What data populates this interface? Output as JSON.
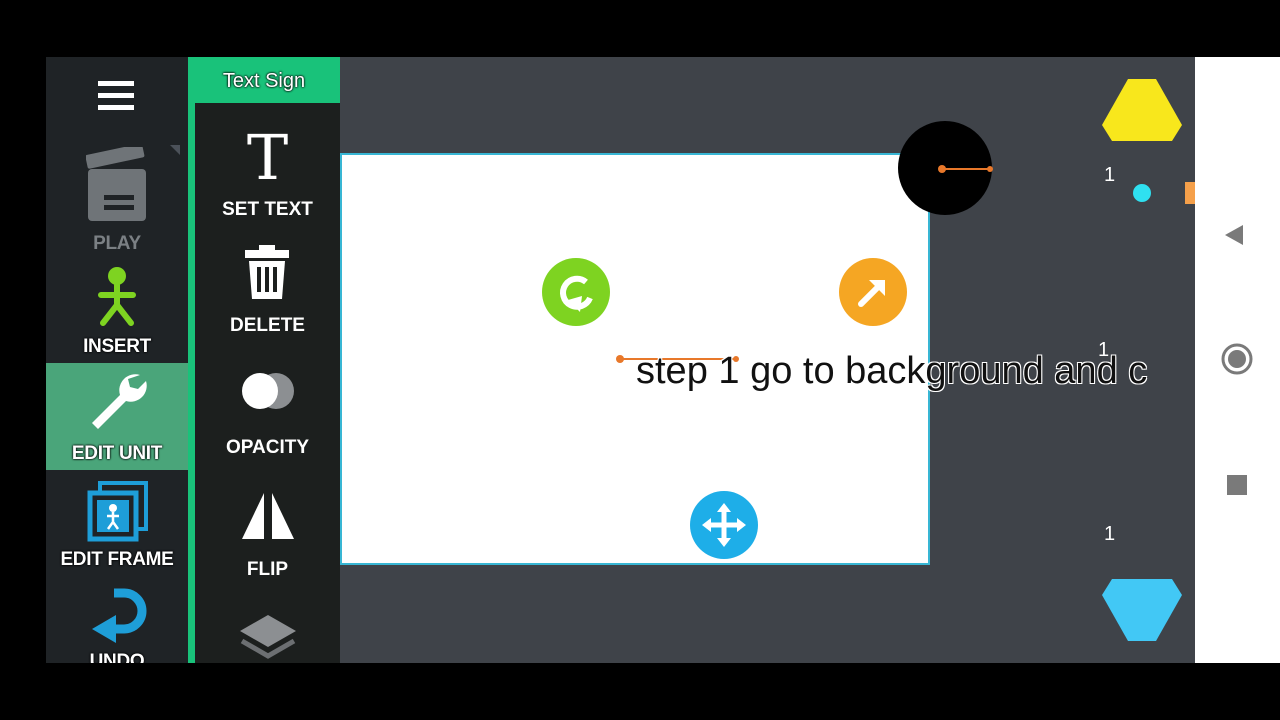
{
  "rail": {
    "items": [
      {
        "label": "PLAY",
        "icon": "clapperboard-icon"
      },
      {
        "label": "INSERT",
        "icon": "stickfigure-icon"
      },
      {
        "label": "EDIT UNIT",
        "icon": "wrench-icon"
      },
      {
        "label": "EDIT FRAME",
        "icon": "frame-icon"
      },
      {
        "label": "UNDO",
        "icon": "undo-icon"
      }
    ]
  },
  "tools": {
    "title": "Text Sign",
    "items": [
      {
        "label": "SET TEXT",
        "icon": "text-T-icon",
        "glyph": "T"
      },
      {
        "label": "DELETE",
        "icon": "trash-icon"
      },
      {
        "label": "OPACITY",
        "icon": "opacity-icon"
      },
      {
        "label": "FLIP",
        "icon": "flip-icon"
      },
      {
        "label": "",
        "icon": "layers-icon"
      }
    ]
  },
  "canvas": {
    "sign_text": "step 1 go to background and c",
    "counters": [
      "1",
      "1",
      "1"
    ]
  },
  "colors": {
    "accent": "#19c27a",
    "active_rail": "#4aa57a",
    "rotate_handle": "#7ed321",
    "scale_handle": "#f5a623",
    "move_handle": "#1eaee8",
    "frame_up": "#f8e71c",
    "frame_down": "#42c8f5",
    "stage_border": "#38b6d4"
  }
}
